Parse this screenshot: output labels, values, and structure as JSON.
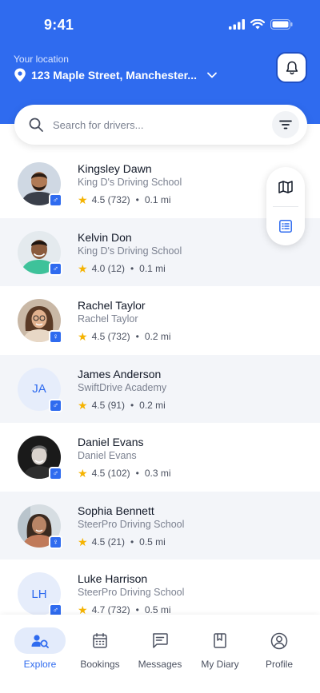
{
  "status_bar": {
    "time": "9:41"
  },
  "location": {
    "label": "Your location",
    "address": "123 Maple Street, Manchester..."
  },
  "search": {
    "placeholder": "Search for drivers..."
  },
  "drivers": [
    {
      "name": "Kingsley Dawn",
      "school": "King D's Driving School",
      "rating": "4.5",
      "reviews": "(732)",
      "distance": "0.1 mi",
      "gender": "♂",
      "avatar": "photo"
    },
    {
      "name": "Kelvin Don",
      "school": "King D's Driving School",
      "rating": "4.0",
      "reviews": "(12)",
      "distance": "0.1 mi",
      "gender": "♂",
      "avatar": "photo"
    },
    {
      "name": "Rachel Taylor",
      "school": "Rachel Taylor",
      "rating": "4.5",
      "reviews": "(732)",
      "distance": "0.2 mi",
      "gender": "♀",
      "avatar": "photo"
    },
    {
      "name": "James Anderson",
      "school": "SwiftDrive Academy",
      "rating": "4.5",
      "reviews": "(91)",
      "distance": "0.2 mi",
      "gender": "♂",
      "initials": "JA"
    },
    {
      "name": "Daniel Evans",
      "school": "Daniel Evans",
      "rating": "4.5",
      "reviews": "(102)",
      "distance": "0.3 mi",
      "gender": "♂",
      "avatar": "photo"
    },
    {
      "name": "Sophia Bennett",
      "school": "SteerPro Driving School",
      "rating": "4.5",
      "reviews": "(21)",
      "distance": "0.5 mi",
      "gender": "♀",
      "avatar": "photo"
    },
    {
      "name": "Luke Harrison",
      "school": "SteerPro Driving School",
      "rating": "4.7",
      "reviews": "(732)",
      "distance": "0.5 mi",
      "gender": "♂",
      "initials": "LH"
    }
  ],
  "view_toggle": {
    "options": [
      "map",
      "list"
    ],
    "selected": "list"
  },
  "tabs": [
    {
      "label": "Explore",
      "icon": "explore-icon",
      "active": true
    },
    {
      "label": "Bookings",
      "icon": "calendar-icon"
    },
    {
      "label": "Messages",
      "icon": "messages-icon"
    },
    {
      "label": "My Diary",
      "icon": "diary-icon"
    },
    {
      "label": "Profile",
      "icon": "profile-icon"
    }
  ],
  "colors": {
    "primary": "#2f6bef",
    "star": "#f5b301",
    "alt_row": "#f3f5f9"
  }
}
